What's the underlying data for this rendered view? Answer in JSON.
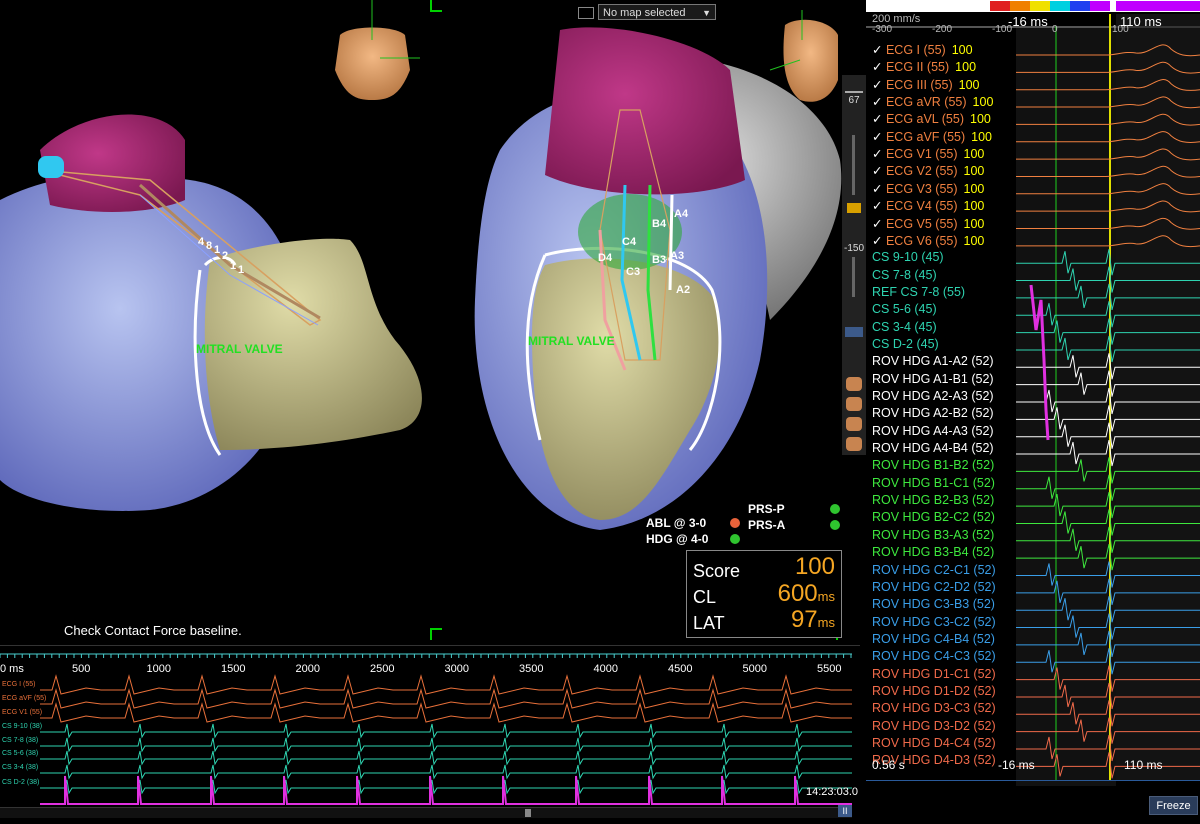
{
  "map_select": {
    "label": "No map selected"
  },
  "viewport": {
    "left_valve_label": "MITRAL VALVE",
    "right_valve_label": "MITRAL VALVE",
    "left_electrode_labels": [
      "4",
      "8",
      "1",
      "2",
      "1",
      "1"
    ],
    "right_electrode_labels": [
      "C4",
      "B4",
      "A4",
      "D4",
      "C3",
      "B3",
      "A3",
      "A2"
    ],
    "tools_value_top": "67",
    "tools_value_mid": "-150"
  },
  "catheters": [
    {
      "label": "ABL @ 3-0",
      "color": "#e8623a"
    },
    {
      "label": "HDG @ 4-0",
      "color": "#2fc42f"
    },
    {
      "label": "PRS-P",
      "color": "#2fc42f"
    },
    {
      "label": "PRS-A",
      "color": "#2fc42f"
    }
  ],
  "score_panel": {
    "score_label": "Score",
    "score_value": "100",
    "cl_label": "CL",
    "cl_value": "600",
    "cl_unit": "ms",
    "lat_label": "LAT",
    "lat_value": "97",
    "lat_unit": "ms"
  },
  "status_message": "Check Contact Force baseline.",
  "bottom_strip": {
    "axis_labels": [
      "0 ms",
      "500",
      "1000",
      "1500",
      "2000",
      "2500",
      "3000",
      "3500",
      "4000",
      "4500",
      "5000",
      "5500"
    ],
    "channels": [
      {
        "label": "ECG I (55)",
        "color": "#e8703a"
      },
      {
        "label": "ECG aVF (55)",
        "color": "#e8703a"
      },
      {
        "label": "ECG V1 (55)",
        "color": "#e8703a"
      },
      {
        "label": "CS  9-10 (38)",
        "color": "#2ed3b0"
      },
      {
        "label": "CS  7-8 (38)",
        "color": "#2ed3b0"
      },
      {
        "label": "CS  5-6 (38)",
        "color": "#2ed3b0"
      },
      {
        "label": "CS  3-4 (38)",
        "color": "#2ed3b0"
      },
      {
        "label": "CS  D-2 (38)",
        "color": "#2ed3b0"
      }
    ],
    "time": "14:23:03.0"
  },
  "right_panel": {
    "scale_label": "200 mm/s",
    "axis_ticks": [
      "-300",
      "-200",
      "-100",
      "0",
      "100"
    ],
    "cursor_left": "-16 ms",
    "cursor_right": "110 ms",
    "bottom_time": "0.56 s",
    "bottom_cursor_left": "-16 ms",
    "bottom_cursor_right": "110 ms",
    "freeze_label": "Freeze",
    "colors": [
      "#ffffff",
      "#e02020",
      "#f08000",
      "#f0e000",
      "#00d0e0",
      "#2040f0",
      "#c000ff"
    ],
    "channels": [
      {
        "label": "ECG I (55)",
        "num": "100",
        "color": "#f08040",
        "check": "✓"
      },
      {
        "label": "ECG II (55)",
        "num": "100",
        "color": "#f08040",
        "check": "✓"
      },
      {
        "label": "ECG III (55)",
        "num": "100",
        "color": "#f08040",
        "check": "✓"
      },
      {
        "label": "ECG aVR (55)",
        "num": "100",
        "color": "#f08040",
        "check": "✓"
      },
      {
        "label": "ECG aVL (55)",
        "num": "100",
        "color": "#f08040",
        "check": "✓"
      },
      {
        "label": "ECG aVF (55)",
        "num": "100",
        "color": "#f08040",
        "check": "✓"
      },
      {
        "label": "ECG V1 (55)",
        "num": "100",
        "color": "#f08040",
        "check": "✓"
      },
      {
        "label": "ECG V2 (55)",
        "num": "100",
        "color": "#f08040",
        "check": "✓"
      },
      {
        "label": "ECG V3 (55)",
        "num": "100",
        "color": "#f08040",
        "check": "✓"
      },
      {
        "label": "ECG V4 (55)",
        "num": "100",
        "color": "#f08040",
        "check": "✓"
      },
      {
        "label": "ECG V5 (55)",
        "num": "100",
        "color": "#f08040",
        "check": "✓"
      },
      {
        "label": "ECG V6 (55)",
        "num": "100",
        "color": "#f08040",
        "check": "✓"
      },
      {
        "label": "CS  9-10 (45)",
        "num": "",
        "color": "#2ed3b0",
        "check": ""
      },
      {
        "label": "CS  7-8 (45)",
        "num": "",
        "color": "#2ed3b0",
        "check": ""
      },
      {
        "label": "REF CS  7-8 (55)",
        "num": "",
        "color": "#2ed3b0",
        "check": ""
      },
      {
        "label": "CS  5-6 (45)",
        "num": "",
        "color": "#2ed3b0",
        "check": ""
      },
      {
        "label": "CS  3-4 (45)",
        "num": "",
        "color": "#2ed3b0",
        "check": ""
      },
      {
        "label": "CS  D-2 (45)",
        "num": "",
        "color": "#2ed3b0",
        "check": ""
      },
      {
        "label": "ROV HDG  A1-A2 (52)",
        "num": "",
        "color": "#ffffff",
        "check": ""
      },
      {
        "label": "ROV HDG  A1-B1 (52)",
        "num": "",
        "color": "#ffffff",
        "check": ""
      },
      {
        "label": "ROV HDG  A2-A3 (52)",
        "num": "",
        "color": "#ffffff",
        "check": ""
      },
      {
        "label": "ROV HDG  A2-B2 (52)",
        "num": "",
        "color": "#ffffff",
        "check": ""
      },
      {
        "label": "ROV HDG  A4-A3 (52)",
        "num": "",
        "color": "#ffffff",
        "check": ""
      },
      {
        "label": "ROV HDG  A4-B4 (52)",
        "num": "",
        "color": "#ffffff",
        "check": ""
      },
      {
        "label": "ROV HDG  B1-B2 (52)",
        "num": "",
        "color": "#3ee83e",
        "check": ""
      },
      {
        "label": "ROV HDG  B1-C1 (52)",
        "num": "",
        "color": "#3ee83e",
        "check": ""
      },
      {
        "label": "ROV HDG  B2-B3 (52)",
        "num": "",
        "color": "#3ee83e",
        "check": ""
      },
      {
        "label": "ROV HDG  B2-C2 (52)",
        "num": "",
        "color": "#3ee83e",
        "check": ""
      },
      {
        "label": "ROV HDG  B3-A3 (52)",
        "num": "",
        "color": "#3ee83e",
        "check": ""
      },
      {
        "label": "ROV HDG  B3-B4 (52)",
        "num": "",
        "color": "#3ee83e",
        "check": ""
      },
      {
        "label": "ROV HDG  C2-C1 (52)",
        "num": "",
        "color": "#3a9ee8",
        "check": ""
      },
      {
        "label": "ROV HDG  C2-D2 (52)",
        "num": "",
        "color": "#3a9ee8",
        "check": ""
      },
      {
        "label": "ROV HDG  C3-B3 (52)",
        "num": "",
        "color": "#3a9ee8",
        "check": ""
      },
      {
        "label": "ROV HDG  C3-C2 (52)",
        "num": "",
        "color": "#3a9ee8",
        "check": ""
      },
      {
        "label": "ROV HDG  C4-B4 (52)",
        "num": "",
        "color": "#3a9ee8",
        "check": ""
      },
      {
        "label": "ROV HDG  C4-C3 (52)",
        "num": "",
        "color": "#3a9ee8",
        "check": ""
      },
      {
        "label": "ROV HDG  D1-C1 (52)",
        "num": "",
        "color": "#f06a4a",
        "check": ""
      },
      {
        "label": "ROV HDG  D1-D2 (52)",
        "num": "",
        "color": "#f06a4a",
        "check": ""
      },
      {
        "label": "ROV HDG  D3-C3 (52)",
        "num": "",
        "color": "#f06a4a",
        "check": ""
      },
      {
        "label": "ROV HDG  D3-D2 (52)",
        "num": "",
        "color": "#f06a4a",
        "check": ""
      },
      {
        "label": "ROV HDG  D4-C4 (52)",
        "num": "",
        "color": "#f06a4a",
        "check": ""
      },
      {
        "label": "ROV HDG  D4-D3 (52)",
        "num": "",
        "color": "#f06a4a",
        "check": ""
      }
    ]
  }
}
